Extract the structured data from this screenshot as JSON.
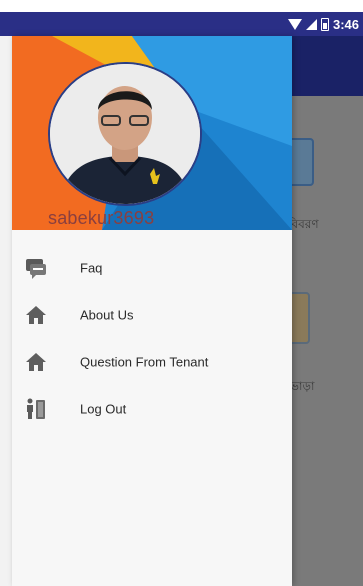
{
  "status_bar": {
    "time": "3:46"
  },
  "drawer": {
    "username": "sabekur3693",
    "menu": [
      {
        "label": "Faq",
        "icon": "faq-icon"
      },
      {
        "label": "About Us",
        "icon": "home-icon"
      },
      {
        "label": "Question From Tenant",
        "icon": "home-icon"
      },
      {
        "label": "Log Out",
        "icon": "logout-icon"
      }
    ]
  },
  "background_app": {
    "labels": [
      "বিবরণ",
      "ভাড়া"
    ]
  },
  "colors": {
    "status_bar": "#2a2f86",
    "header_orange": "#f26b21",
    "header_blue": "#1e84d0",
    "header_yellow": "#f2b51c"
  }
}
